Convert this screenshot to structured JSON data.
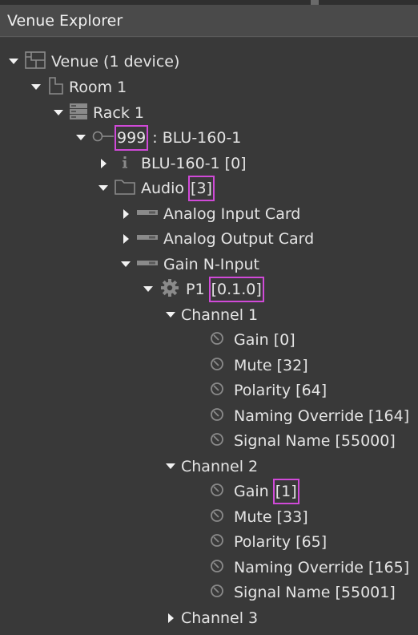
{
  "window": {
    "title": "Venue Explorer"
  },
  "tree": {
    "venue": "Venue (1 device)",
    "room": "Room 1",
    "rack": "Rack 1",
    "device": {
      "id": "999",
      "sep": " : ",
      "name": "BLU-160-1"
    },
    "info": "BLU-160-1 [0]",
    "audio": {
      "label": "Audio ",
      "count": "[3]"
    },
    "cards": [
      "Analog Input Card",
      "Analog Output Card",
      "Gain N-Input"
    ],
    "processor": {
      "label": "P1 ",
      "address": "[0.1.0]"
    },
    "channel1": {
      "label": "Channel 1",
      "params": [
        "Gain [0]",
        "Mute [32]",
        "Polarity [64]",
        "Naming Override [164]",
        "Signal Name [55000]"
      ]
    },
    "channel2": {
      "label": "Channel 2",
      "gain": {
        "label": "Gain ",
        "id": "[1]"
      },
      "params": [
        "Mute [33]",
        "Polarity [65]",
        "Naming Override [165]",
        "Signal Name [55001]"
      ]
    },
    "channel3": {
      "label": "Channel 3"
    }
  },
  "colors": {
    "highlight": "#d04ad8",
    "background": "#393939",
    "titlebar": "#4a4a4a"
  }
}
